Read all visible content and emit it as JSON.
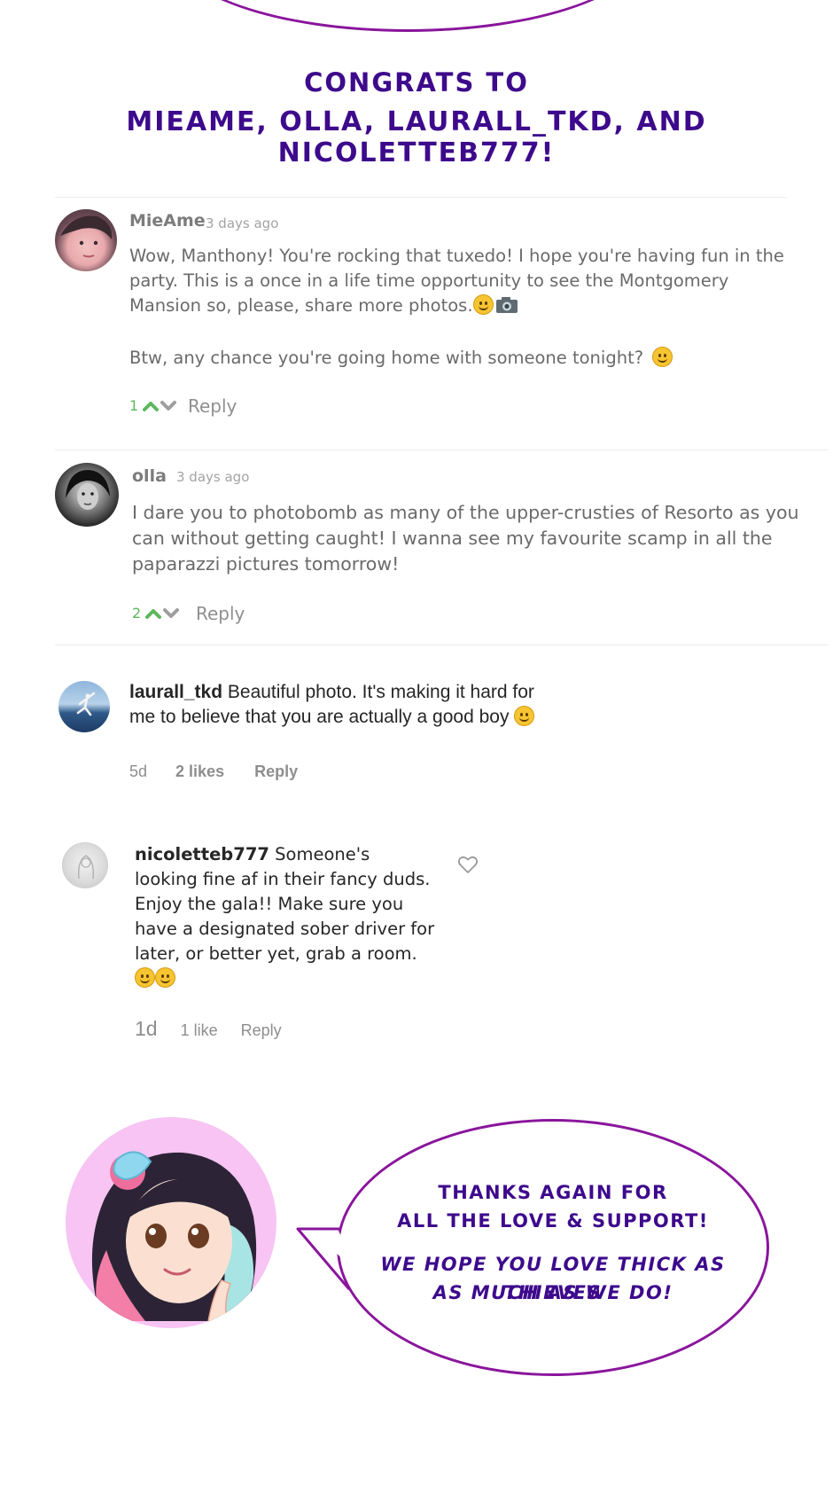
{
  "heading": {
    "line1": "CONGRATS TO",
    "line2": "MIEAME, OLLA, LAURALL_TKD, AND NICOLETTEB777!"
  },
  "comments": [
    {
      "username": "MieAme",
      "time": "3 days ago",
      "paragraph1": "Wow, Manthony! You're rocking that tuxedo! I hope you're having fun in the party. This is a once in a life time opportunity to see the Montgomery Mansion so, please, share more photos.",
      "paragraph2": "Btw, any chance you're going home with someone tonight?",
      "votes": "1",
      "reply": "Reply"
    },
    {
      "username": "olla",
      "time": "3 days ago",
      "text": "I dare you to photobomb as many of the upper-crusties of Resorto as you can without getting caught! I wanna see my favourite scamp in all the paparazzi pictures tomorrow!",
      "votes": "2",
      "reply": "Reply"
    }
  ],
  "ig_comments": [
    {
      "username": "laurall_tkd",
      "text": "Beautiful photo. It's making it hard for me to believe that you are actually a good boy",
      "age": "5d",
      "likes": "2 likes",
      "reply": "Reply"
    },
    {
      "username": "nicoletteb777",
      "text": "Someone's looking fine af in their fancy duds. Enjoy the gala!! Make sure you have a designated sober driver for later, or better yet, grab a room.",
      "age": "1d",
      "likes": "1 like",
      "reply": "Reply"
    }
  ],
  "closing": {
    "line1": "THANKS AGAIN FOR",
    "line2": "ALL THE LOVE & SUPPORT!",
    "line3": "WE HOPE YOU LOVE THICK AS THIEVES",
    "line4": "AS MUCH AS WE DO!"
  },
  "colors": {
    "accent_purple": "#8a159c",
    "heading_indigo": "#3d0a8c",
    "upvote_green": "#5cb85c"
  },
  "icons": [
    "upvote-icon",
    "downvote-icon",
    "heart-icon",
    "emoji-grin-icon",
    "camera-icon",
    "emoji-wink-icon"
  ]
}
